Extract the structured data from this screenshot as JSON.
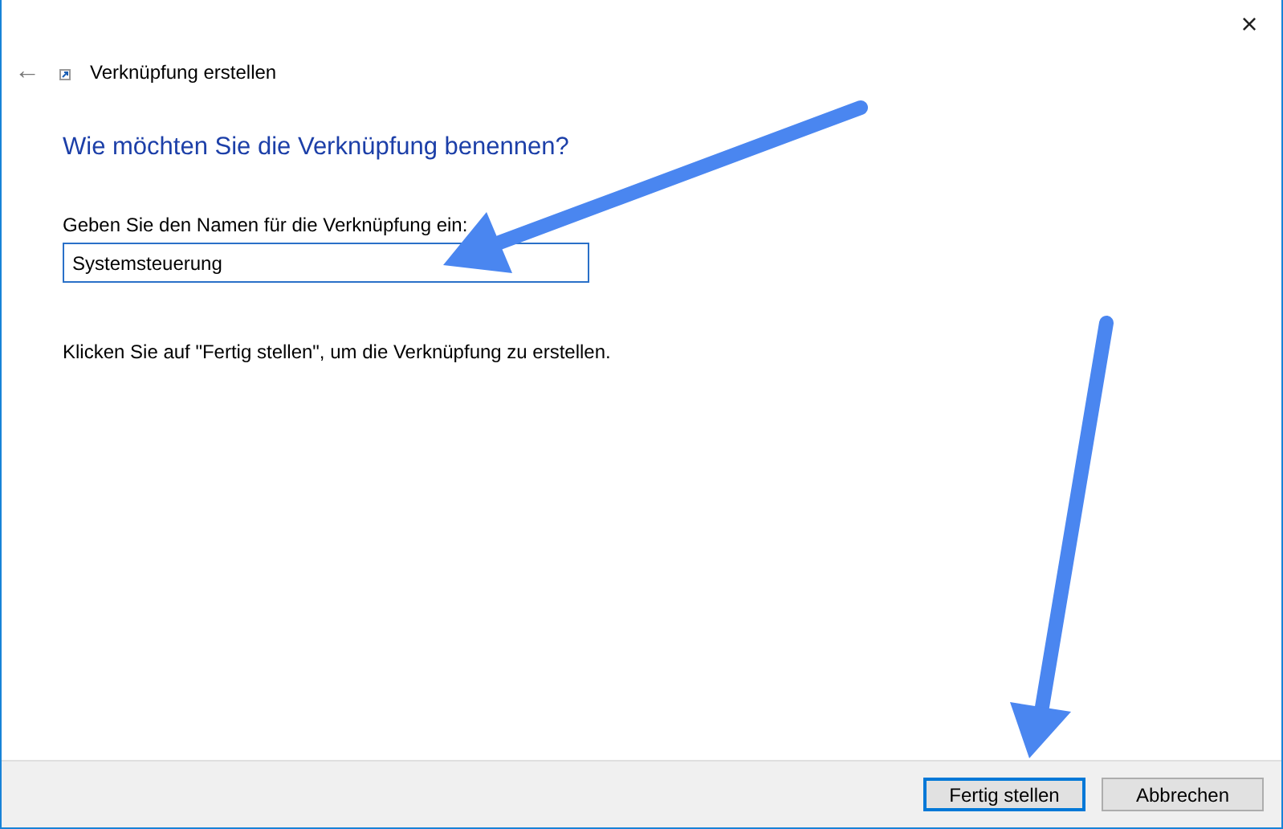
{
  "window": {
    "close": "×"
  },
  "header": {
    "back": "←",
    "title": "Verknüpfung erstellen"
  },
  "heading": "Wie möchten Sie die Verknüpfung benennen?",
  "name_field": {
    "label": "Geben Sie den Namen für die Verknüpfung ein:",
    "value": "Systemsteuerung"
  },
  "instruction": "Klicken Sie auf \"Fertig stellen\", um die Verknüpfung zu erstellen.",
  "buttons": [
    {
      "label": "Fertig stellen",
      "default": true
    },
    {
      "label": "Abbrechen",
      "default": false
    }
  ]
}
